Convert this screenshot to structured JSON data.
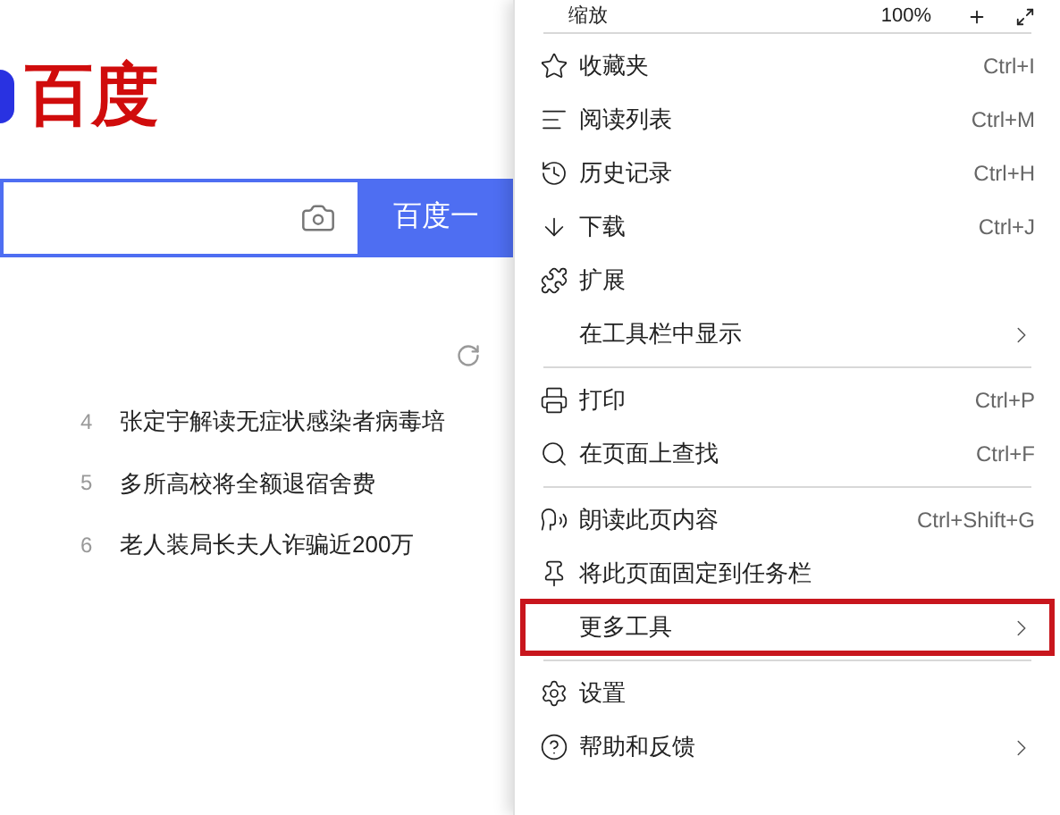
{
  "page": {
    "logo_text": "百度",
    "search": {
      "button": "百度一"
    },
    "news": [
      {
        "rank": "4",
        "title": "张定宇解读无症状感染者病毒培"
      },
      {
        "rank": "5",
        "title": "多所高校将全额退宿舍费"
      },
      {
        "rank": "6",
        "title": "老人装局长夫人诈骗近200万"
      }
    ]
  },
  "menu": {
    "zoom": {
      "label": "缩放",
      "value": "100%"
    },
    "groups": [
      [
        {
          "label": "收藏夹",
          "shortcut": "Ctrl+I",
          "submenu": false,
          "highlighted": false
        },
        {
          "label": "阅读列表",
          "shortcut": "Ctrl+M",
          "submenu": false,
          "highlighted": false
        },
        {
          "label": "历史记录",
          "shortcut": "Ctrl+H",
          "submenu": false,
          "highlighted": false
        },
        {
          "label": "下载",
          "shortcut": "Ctrl+J",
          "submenu": false,
          "highlighted": false
        },
        {
          "label": "扩展",
          "submenu": false,
          "highlighted": false
        },
        {
          "label": "在工具栏中显示",
          "submenu": true,
          "highlighted": false
        }
      ],
      [
        {
          "label": "打印",
          "shortcut": "Ctrl+P",
          "submenu": false,
          "highlighted": false
        },
        {
          "label": "在页面上查找",
          "shortcut": "Ctrl+F",
          "submenu": false,
          "highlighted": false
        }
      ],
      [
        {
          "label": "朗读此页内容",
          "shortcut": "Ctrl+Shift+G",
          "submenu": false,
          "highlighted": false
        },
        {
          "label": "将此页面固定到任务栏",
          "submenu": false,
          "highlighted": false
        },
        {
          "label": "更多工具",
          "submenu": true,
          "highlighted": true
        }
      ],
      [
        {
          "label": "设置",
          "submenu": false,
          "highlighted": false
        },
        {
          "label": "帮助和反馈",
          "submenu": true,
          "highlighted": false
        }
      ]
    ]
  }
}
